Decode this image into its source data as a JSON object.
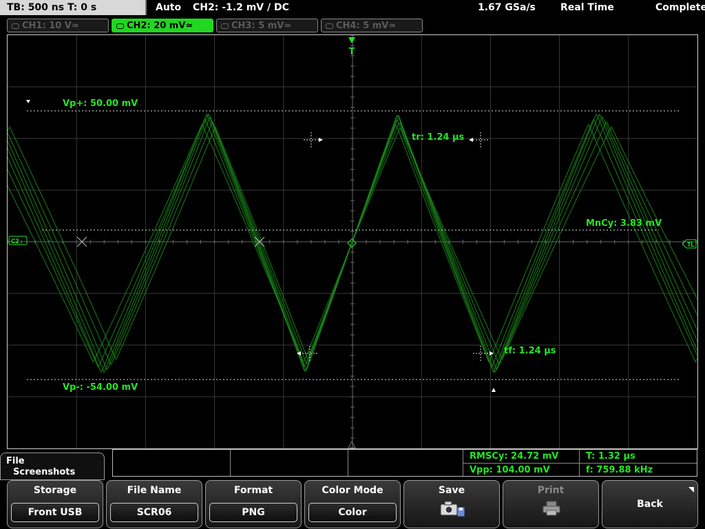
{
  "status_bar": {
    "timebase": "TB: 500 ns   T: 0 s",
    "trigger_mode": "Auto",
    "trigger_info": "CH2: -1.2 mV ∕ DC",
    "sample_rate": "1.67 GSa/s",
    "acq_mode": "Real Time",
    "acq_state": "Complete"
  },
  "channels": [
    {
      "label": "CH1: 10 V≃",
      "active": false
    },
    {
      "label": "CH2: 20 mV≃",
      "active": true
    },
    {
      "label": "CH3: 5 mV≃",
      "active": false
    },
    {
      "label": "CH4: 5 mV≃",
      "active": false
    }
  ],
  "screen": {
    "trigger_marker": "T",
    "channel_marker": "C2",
    "trigger_level_marker": "TL",
    "measurements": {
      "vp_plus": "Vp+: 50.00 mV",
      "vp_minus": "Vp-: -54.00 mV",
      "rise_time": "tr: 1.24 µs",
      "fall_time": "tf: 1.24 µs",
      "mean_cycle": "MnCy: 3.83 mV"
    }
  },
  "measure_bar": {
    "rms_cycle": "RMSCy: 24.72 mV",
    "period": "T: 1.32 µs",
    "vpp": "Vpp: 104.00 mV",
    "frequency": "f: 759.88 kHz"
  },
  "menu": {
    "title_line1": "File",
    "title_line2": "Screenshots",
    "softkeys": [
      {
        "caption": "Storage",
        "value": "Front USB"
      },
      {
        "caption": "File Name",
        "value": "SCR06"
      },
      {
        "caption": "Format",
        "value": "PNG"
      },
      {
        "caption": "Color Mode",
        "value": "Color"
      },
      {
        "caption": "Save",
        "icon": "camera-save-icon"
      },
      {
        "caption": "Print",
        "icon": "printer-icon",
        "disabled": true
      },
      {
        "caption": "Back"
      }
    ]
  },
  "colors": {
    "waveform": "#1a8a1a",
    "accent": "#22e622",
    "grid": "#3a3a3a"
  }
}
